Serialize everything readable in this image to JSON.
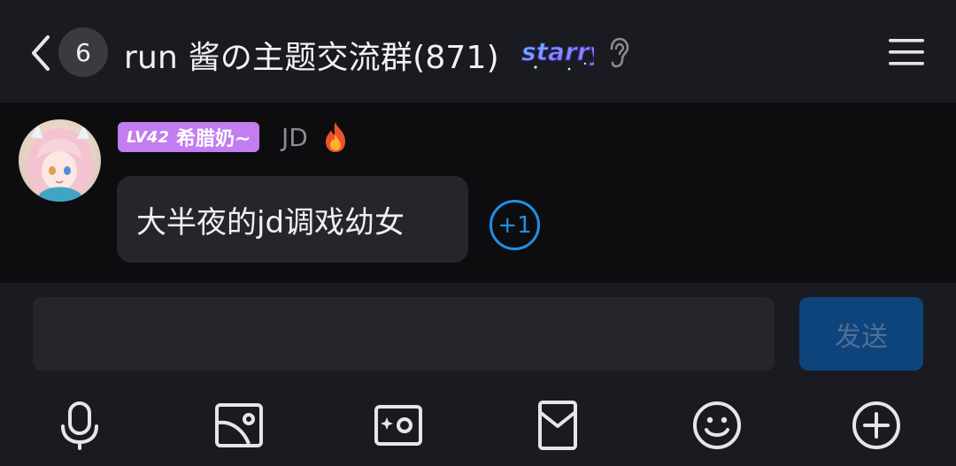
{
  "header": {
    "unread_count": "6",
    "title": "run 酱の主题交流群(871)",
    "logo_text": "starry",
    "menu_icon": "hamburger-menu-icon"
  },
  "message": {
    "level": "LV42",
    "nickname": "希腊奶~",
    "sender": "JD",
    "text": "大半夜的jd调戏幼女",
    "reaction": "+1",
    "tag_color": "#c27df0",
    "reaction_color": "#1e90e8"
  },
  "composer": {
    "input_value": "",
    "send_label": "发送",
    "send_color": "#0e447c",
    "toolbar_icons": [
      "microphone-icon",
      "image-icon",
      "photo-icon",
      "red-packet-icon",
      "emoji-icon",
      "plus-icon"
    ]
  }
}
